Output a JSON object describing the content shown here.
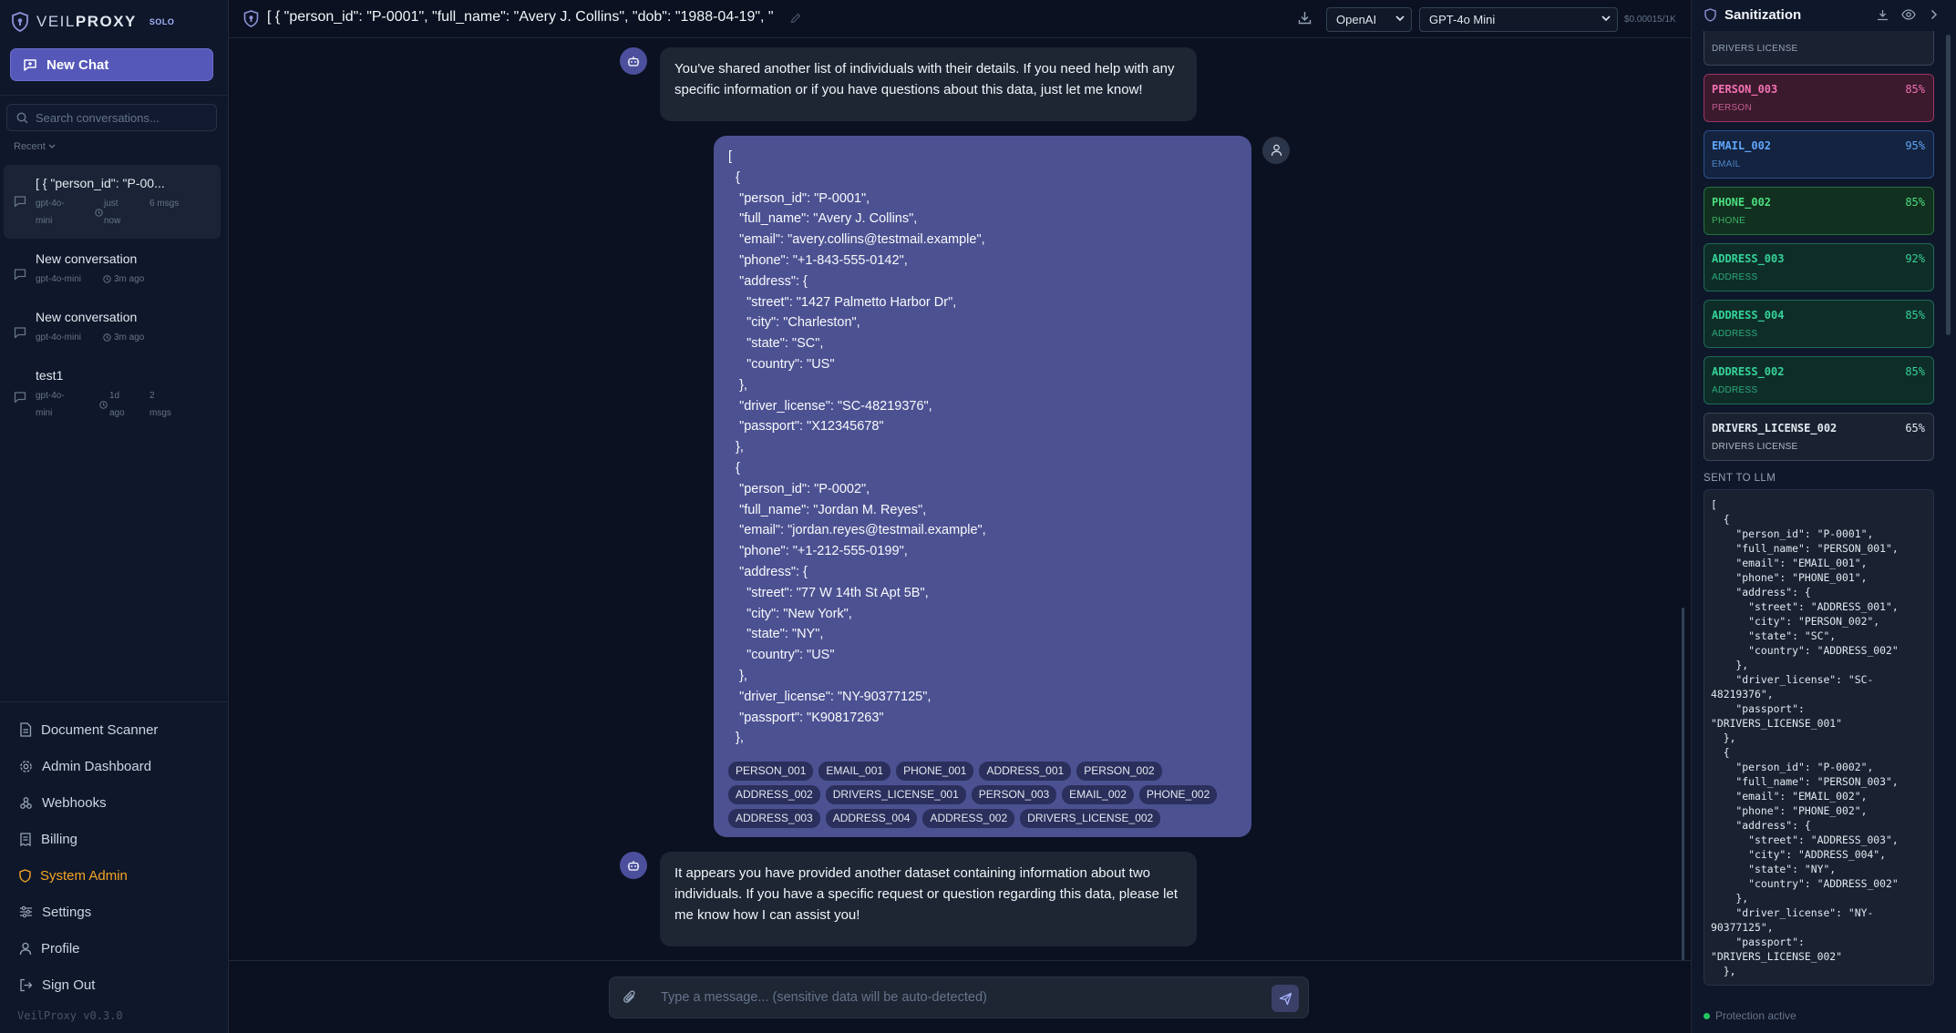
{
  "brand": {
    "name_light": "VEIL",
    "name_bold": "PROXY",
    "plan": "SOLO"
  },
  "sidebar": {
    "new_chat": "New Chat",
    "search_placeholder": "Search conversations...",
    "recent_label": "Recent",
    "conversations": [
      {
        "title": "[ { \"person_id\": \"P-00...",
        "model": "gpt-4o-mini",
        "time": "just now",
        "msgs": "6 msgs"
      },
      {
        "title": "New conversation",
        "model": "gpt-4o-mini",
        "time": "3m ago"
      },
      {
        "title": "New conversation",
        "model": "gpt-4o-mini",
        "time": "3m ago"
      },
      {
        "title": "test1",
        "model": "gpt-4o-mini",
        "time": "1d ago",
        "msgs": "2 msgs"
      }
    ],
    "menu": [
      {
        "label": "Document Scanner",
        "icon": "document-icon"
      },
      {
        "label": "Admin Dashboard",
        "icon": "gear-icon"
      },
      {
        "label": "Webhooks",
        "icon": "webhook-icon"
      },
      {
        "label": "Billing",
        "icon": "credit-card-icon"
      },
      {
        "label": "System Admin",
        "icon": "shield-icon"
      },
      {
        "label": "Settings",
        "icon": "sliders-icon"
      },
      {
        "label": "Profile",
        "icon": "user-icon"
      },
      {
        "label": "Sign Out",
        "icon": "sign-out-icon"
      }
    ],
    "version": "VeilProxy v0.3.0"
  },
  "topbar": {
    "title": "[ { \"person_id\": \"P-0001\", \"full_name\": \"Avery J. Collins\", \"dob\": \"1988-04-19\", \"",
    "provider": "OpenAI",
    "model": "GPT-4o Mini",
    "cost": "$0.00015/1K"
  },
  "chat": {
    "bot_msg_1": "You've shared another list of individuals with their details. If you need help with any specific information or if you have questions about this data, just let me know!",
    "user_msg": "[\n  {\n   \"person_id\": \"P-0001\",\n   \"full_name\": \"Avery J. Collins\",\n   \"email\": \"avery.collins@testmail.example\",\n   \"phone\": \"+1-843-555-0142\",\n   \"address\": {\n     \"street\": \"1427 Palmetto Harbor Dr\",\n     \"city\": \"Charleston\",\n     \"state\": \"SC\",\n     \"country\": \"US\"\n   },\n   \"driver_license\": \"SC-48219376\",\n   \"passport\": \"X12345678\"\n  },\n  {\n   \"person_id\": \"P-0002\",\n   \"full_name\": \"Jordan M. Reyes\",\n   \"email\": \"jordan.reyes@testmail.example\",\n   \"phone\": \"+1-212-555-0199\",\n   \"address\": {\n     \"street\": \"77 W 14th St Apt 5B\",\n     \"city\": \"New York\",\n     \"state\": \"NY\",\n     \"country\": \"US\"\n   },\n   \"driver_license\": \"NY-90377125\",\n   \"passport\": \"K90817263\"\n  },",
    "tokens": [
      "PERSON_001",
      "EMAIL_001",
      "PHONE_001",
      "ADDRESS_001",
      "PERSON_002",
      "ADDRESS_002",
      "DRIVERS_LICENSE_001",
      "PERSON_003",
      "EMAIL_002",
      "PHONE_002",
      "ADDRESS_003",
      "ADDRESS_004",
      "ADDRESS_002",
      "DRIVERS_LICENSE_002"
    ],
    "bot_msg_2": "It appears you have provided another dataset containing information about two individuals. If you have a specific request or question regarding this data, please let me know how I can assist you!",
    "composer_placeholder": "Type a message... (sensitive data will be auto-detected)"
  },
  "sanitization": {
    "title": "Sanitization",
    "partial_type": "DRIVERS LICENSE",
    "entities": [
      {
        "name": "PERSON_003",
        "pct": "85%",
        "type": "PERSON",
        "color": "#f472b6",
        "bg": "#3a1a2c",
        "border": "#9d3465"
      },
      {
        "name": "EMAIL_002",
        "pct": "95%",
        "type": "EMAIL",
        "color": "#60a5fa",
        "bg": "#14233f",
        "border": "#2c4f8f"
      },
      {
        "name": "PHONE_002",
        "pct": "85%",
        "type": "PHONE",
        "color": "#4ade80",
        "bg": "#12301f",
        "border": "#25703f"
      },
      {
        "name": "ADDRESS_003",
        "pct": "92%",
        "type": "ADDRESS",
        "color": "#34d399",
        "bg": "#0f2d28",
        "border": "#1f6b57"
      },
      {
        "name": "ADDRESS_004",
        "pct": "85%",
        "type": "ADDRESS",
        "color": "#34d399",
        "bg": "#0f2d28",
        "border": "#1f6b57"
      },
      {
        "name": "ADDRESS_002",
        "pct": "85%",
        "type": "ADDRESS",
        "color": "#34d399",
        "bg": "#0f2d28",
        "border": "#1f6b57"
      },
      {
        "name": "DRIVERS_LICENSE_002",
        "pct": "65%",
        "type": "DRIVERS LICENSE",
        "color": "#e2e8f0",
        "bg": "#1a2231",
        "border": "#3a4456"
      }
    ],
    "sent_label": "SENT TO LLM",
    "sent_text": "[\n  {\n    \"person_id\": \"P-0001\",\n    \"full_name\": \"PERSON_001\",\n    \"email\": \"EMAIL_001\",\n    \"phone\": \"PHONE_001\",\n    \"address\": {\n      \"street\": \"ADDRESS_001\",\n      \"city\": \"PERSON_002\",\n      \"state\": \"SC\",\n      \"country\": \"ADDRESS_002\"\n    },\n    \"driver_license\": \"SC-\n48219376\",\n    \"passport\":\n\"DRIVERS_LICENSE_001\"\n  },\n  {\n    \"person_id\": \"P-0002\",\n    \"full_name\": \"PERSON_003\",\n    \"email\": \"EMAIL_002\",\n    \"phone\": \"PHONE_002\",\n    \"address\": {\n      \"street\": \"ADDRESS_003\",\n      \"city\": \"ADDRESS_004\",\n      \"state\": \"NY\",\n      \"country\": \"ADDRESS_002\"\n    },\n    \"driver_license\": \"NY-\n90377125\",\n    \"passport\":\n\"DRIVERS_LICENSE_002\"\n  },",
    "status": "Protection active"
  },
  "colors": {
    "accent": "#5558b8",
    "admin": "#f5a524",
    "user_bubble": "#4c5192"
  }
}
